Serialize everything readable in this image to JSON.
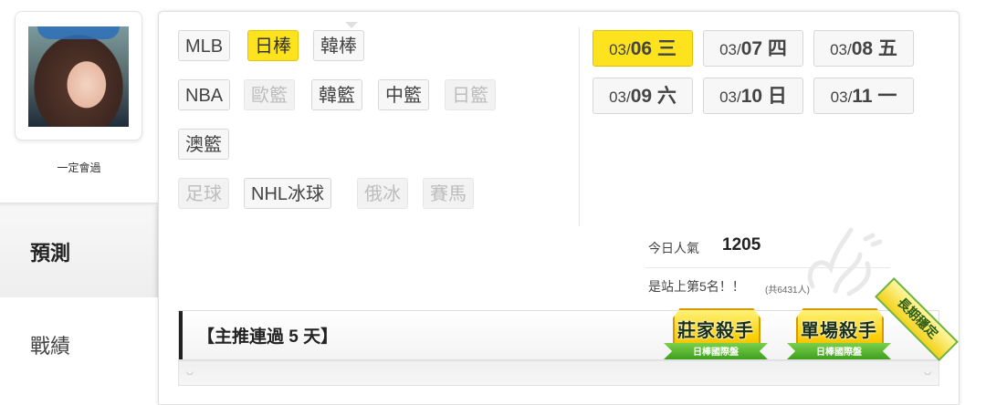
{
  "user": {
    "name": "一定會過"
  },
  "nav": {
    "items": [
      {
        "label": "預測"
      },
      {
        "label": "戰績"
      }
    ]
  },
  "sports": [
    {
      "label": "MLB",
      "state": "normal"
    },
    {
      "label": "日棒",
      "state": "active"
    },
    {
      "label": "韓棒",
      "state": "normal"
    },
    {
      "label": "NBA",
      "state": "normal"
    },
    {
      "label": "歐籃",
      "state": "disabled"
    },
    {
      "label": "韓籃",
      "state": "normal"
    },
    {
      "label": "中籃",
      "state": "normal"
    },
    {
      "label": "日籃",
      "state": "disabled"
    },
    {
      "label": "澳籃",
      "state": "normal"
    },
    {
      "label": "足球",
      "state": "disabled"
    },
    {
      "label": "NHL冰球",
      "state": "normal"
    },
    {
      "label": "俄冰",
      "state": "disabled"
    },
    {
      "label": "賽馬",
      "state": "disabled"
    }
  ],
  "dates": [
    {
      "month": "03/",
      "day": "06",
      "weekday": " 三",
      "active": true
    },
    {
      "month": "03/",
      "day": "07",
      "weekday": " 四",
      "active": false
    },
    {
      "month": "03/",
      "day": "08",
      "weekday": " 五",
      "active": false
    },
    {
      "month": "03/",
      "day": "09",
      "weekday": " 六",
      "active": false
    },
    {
      "month": "03/",
      "day": "10",
      "weekday": " 日",
      "active": false
    },
    {
      "month": "03/",
      "day": "11",
      "weekday": " 一",
      "active": false
    }
  ],
  "popularity": {
    "label": "今日人氣",
    "count": "1205",
    "rank_text": "是站上第5名！！",
    "total": "(共6431人)"
  },
  "streak": {
    "title": "【主推連過 5 天】"
  },
  "badges": [
    {
      "title": "莊家殺手",
      "subtitle": "日棒國際盤"
    },
    {
      "title": "單場殺手",
      "subtitle": "日棒國際盤"
    }
  ],
  "corner_badge": {
    "label": "長期穩定"
  },
  "colors": {
    "accent": "#fde21e",
    "badge_gold": "#fbd20a",
    "ribbon_green": "#3f9f1f"
  }
}
